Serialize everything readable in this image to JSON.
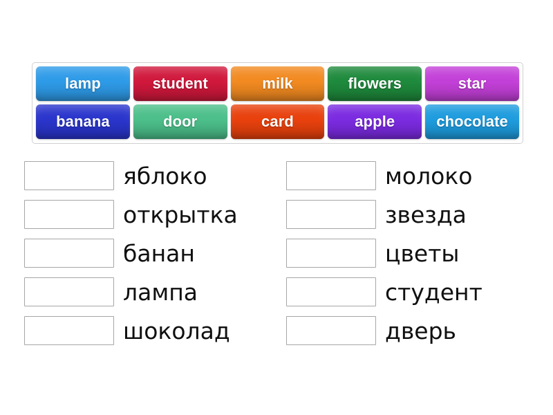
{
  "page": {
    "background_color": "#ffffff",
    "type": "matching-exercise"
  },
  "word_bank": {
    "border_color": "#d0d0d0",
    "rows": [
      [
        {
          "label": "lamp",
          "color": "#2E9BE8"
        },
        {
          "label": "student",
          "color": "#D0183C"
        },
        {
          "label": "milk",
          "color": "#F28A21"
        },
        {
          "label": "flowers",
          "color": "#1E8A3C"
        },
        {
          "label": "star",
          "color": "#C340D8"
        }
      ],
      [
        {
          "label": "banana",
          "color": "#2A35CC"
        },
        {
          "label": "door",
          "color": "#4CBF8A"
        },
        {
          "label": "card",
          "color": "#E8410D"
        },
        {
          "label": "apple",
          "color": "#7B2BE0"
        },
        {
          "label": "chocolate",
          "color": "#1E9CDE"
        }
      ]
    ]
  },
  "answers": {
    "left_column": [
      {
        "box_value": "",
        "label": "яблоко"
      },
      {
        "box_value": "",
        "label": "открытка"
      },
      {
        "box_value": "",
        "label": "банан"
      },
      {
        "box_value": "",
        "label": "лампа"
      },
      {
        "box_value": "",
        "label": "шоколад"
      }
    ],
    "right_column": [
      {
        "box_value": "",
        "label": "молоко"
      },
      {
        "box_value": "",
        "label": "звезда"
      },
      {
        "box_value": "",
        "label": "цветы"
      },
      {
        "box_value": "",
        "label": "студент"
      },
      {
        "box_value": "",
        "label": "дверь"
      }
    ]
  }
}
